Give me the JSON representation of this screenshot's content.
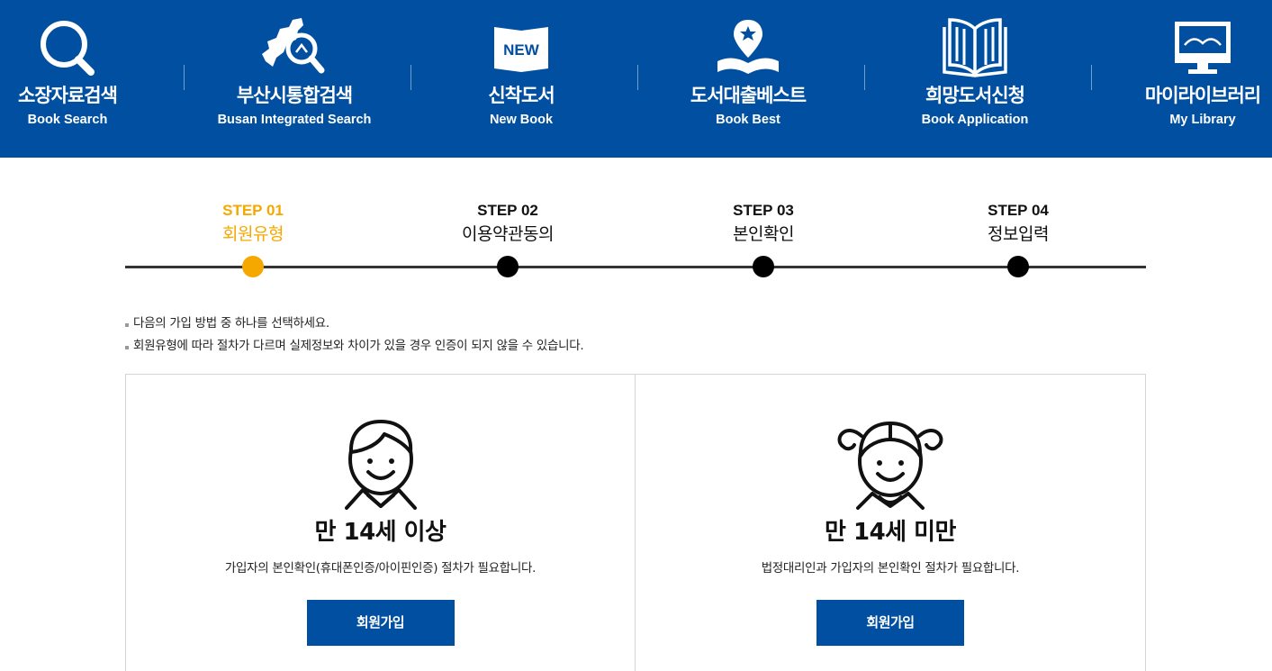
{
  "nav": {
    "items": [
      {
        "ko": "소장자료검색",
        "en": "Book Search",
        "icon": "search-icon"
      },
      {
        "ko": "부산시통합검색",
        "en": "Busan Integrated Search",
        "icon": "busan-map-search-icon"
      },
      {
        "ko": "신착도서",
        "en": "New Book",
        "icon": "new-book-icon"
      },
      {
        "ko": "도서대출베스트",
        "en": "Book Best",
        "icon": "best-book-icon"
      },
      {
        "ko": "희망도서신청",
        "en": "Book Application",
        "icon": "open-book-icon"
      },
      {
        "ko": "마이라이브러리",
        "en": "My Library",
        "icon": "monitor-icon"
      }
    ]
  },
  "steps": [
    {
      "num": "STEP 01",
      "label": "회원유형",
      "active": true
    },
    {
      "num": "STEP 02",
      "label": "이용약관동의",
      "active": false
    },
    {
      "num": "STEP 03",
      "label": "본인확인",
      "active": false
    },
    {
      "num": "STEP 04",
      "label": "정보입력",
      "active": false
    }
  ],
  "notes": [
    "다음의 가입 방법 중 하나를 선택하세요.",
    "회원유형에 따라 절차가 다르며 실제정보와 차이가 있을 경우 인증이 되지 않을 수 있습니다."
  ],
  "join": {
    "adult": {
      "title": "만 14세 이상",
      "desc": "가입자의 본인확인(휴대폰인증/아이핀인증) 절차가 필요합니다.",
      "button": "회원가입",
      "icon": "boy-avatar-icon"
    },
    "child": {
      "title": "만 14세 미만",
      "desc": "법정대리인과 가입자의 본인확인 절차가 필요합니다.",
      "button": "회원가입",
      "icon": "girl-avatar-icon"
    }
  },
  "colors": {
    "brand": "#004fa0",
    "active_step": "#f5a800"
  }
}
